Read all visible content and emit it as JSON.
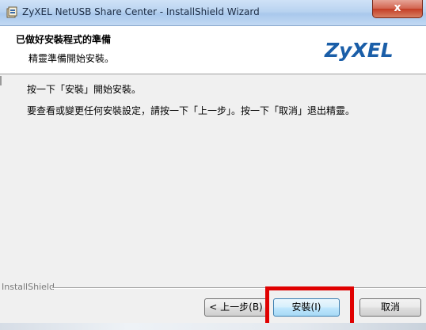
{
  "window": {
    "title": "ZyXEL NetUSB Share Center  - InstallShield Wizard",
    "close_glyph": "x"
  },
  "header": {
    "title": "已做好安裝程式的準備",
    "subtitle": "精靈準備開始安裝。",
    "logo_text": "ZyXEL"
  },
  "body": {
    "line1": "按一下「安裝」開始安裝。",
    "line2": "要查看或變更任何安裝設定，請按一下「上一步」。按一下「取消」退出精靈。"
  },
  "footer": {
    "group_label": "InstallShield"
  },
  "buttons": {
    "back": "< 上一步(B)",
    "install": "安裝(I)",
    "cancel": "取消"
  },
  "colors": {
    "highlight": "#e00000",
    "logo_blue": "#1a5ea8"
  },
  "icons": {
    "title_icon": "installer-icon",
    "close": "close-icon"
  }
}
